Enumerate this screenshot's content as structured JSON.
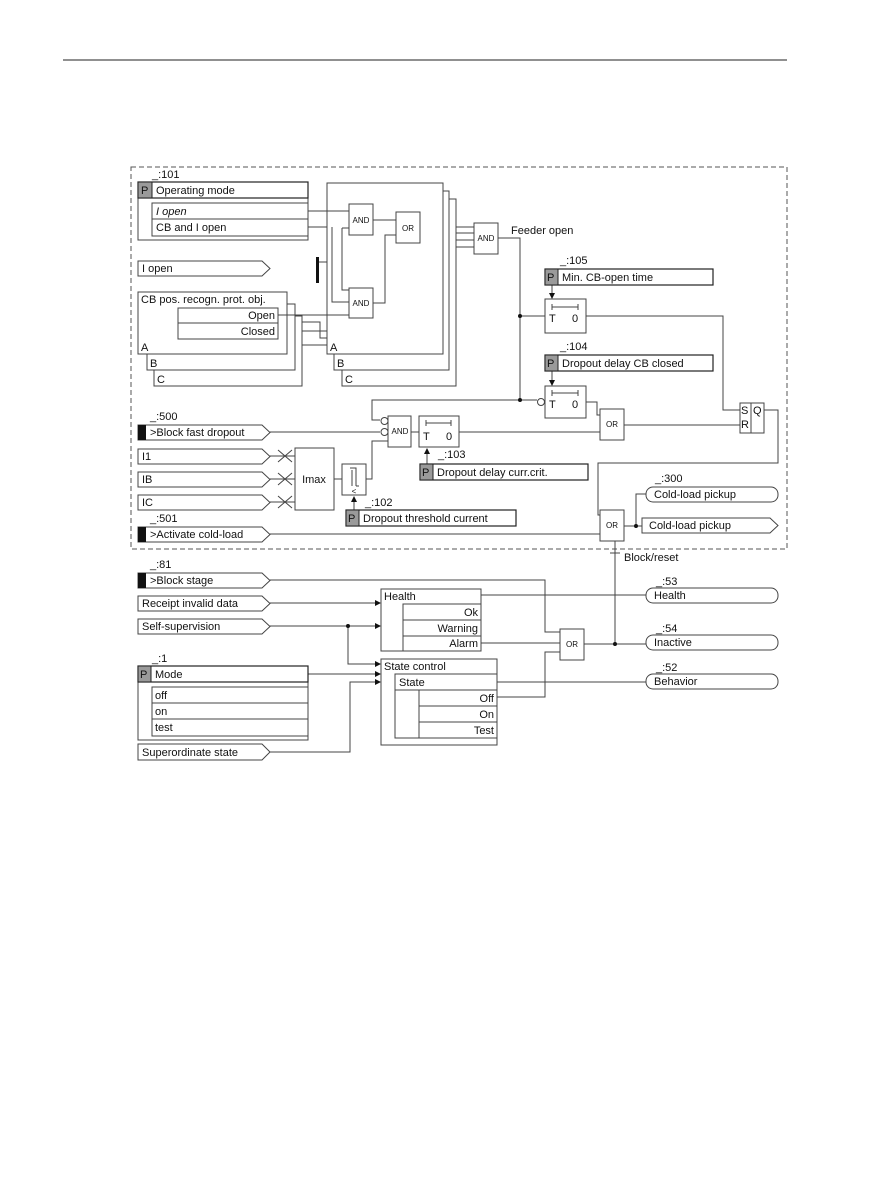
{
  "colors": {
    "line": "#444444",
    "parameter_flag": "#9a9a9a",
    "binary_input_flag": "#111111",
    "border_dashed": "#555555"
  },
  "parameter_flag_letter": "P",
  "operating_mode": {
    "id": "_:101",
    "title": "Operating mode",
    "options": [
      "I open",
      "CB and I open"
    ]
  },
  "inputs": {
    "i_open": "I open",
    "block_fast_dropout": {
      "id": "_:500",
      "label": ">Block fast dropout"
    },
    "i1": "I1",
    "ib": "IB",
    "ic": "IC",
    "activate_cold_load": {
      "id": "_:501",
      "label": ">Activate cold-load"
    },
    "block_stage": {
      "id": "_:81",
      "label": ">Block stage"
    },
    "receipt_invalid_data": "Receipt invalid data",
    "self_supervision": "Self-supervision",
    "superordinate_state": "Superordinate state"
  },
  "cb_pos": {
    "title": "CB pos. recogn. prot. obj.",
    "open": "Open",
    "closed": "Closed",
    "phases": [
      "A",
      "B",
      "C"
    ]
  },
  "gates": {
    "and": "AND",
    "or": "OR",
    "imax": "Imax",
    "sr_s": "S",
    "sr_r": "R",
    "sr_q": "Q",
    "timer_t": "T",
    "timer_0": "0",
    "threshold_symbol": "<"
  },
  "feeder_open": "Feeder open",
  "params": {
    "min_cb_open_time": {
      "id": "_:105",
      "label": "Min. CB-open time"
    },
    "dropout_delay_cb_closed": {
      "id": "_:104",
      "label": "Dropout delay CB closed"
    },
    "dropout_delay_curr_crit": {
      "id": "_:103",
      "label": "Dropout delay curr.crit."
    },
    "dropout_threshold_current": {
      "id": "_:102",
      "label": "Dropout threshold current"
    }
  },
  "outputs": {
    "cold_load_pickup_1": {
      "id": "_:300",
      "label": "Cold-load pickup"
    },
    "cold_load_pickup_2": "Cold-load pickup",
    "block_reset": "Block/reset",
    "health": {
      "id": "_:53",
      "label": "Health"
    },
    "inactive": {
      "id": "_:54",
      "label": "Inactive"
    },
    "behavior": {
      "id": "_:52",
      "label": "Behavior"
    }
  },
  "health_block": {
    "title": "Health",
    "rows": [
      "Ok",
      "Warning",
      "Alarm"
    ]
  },
  "mode": {
    "id": "_:1",
    "title": "Mode",
    "options": [
      "off",
      "on",
      "test"
    ]
  },
  "state_control": {
    "title": "State control",
    "state": "State",
    "rows": [
      "Off",
      "On",
      "Test"
    ]
  }
}
